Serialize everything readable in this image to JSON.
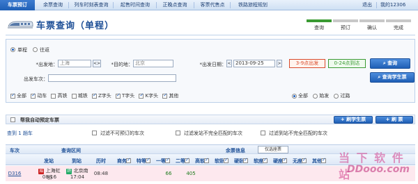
{
  "nav": {
    "tabs": [
      "车票预订",
      "余票查询",
      "列车时刻表查询",
      "起售时间查询",
      "正晚点查询",
      "客票代售点",
      "铁路旅程规划"
    ],
    "active_index": 0,
    "user_text": "我的12306",
    "logout": "退出"
  },
  "header": {
    "title": "车票查询（单程）",
    "steps": [
      {
        "label": "查询",
        "done": true
      },
      {
        "label": "预订",
        "done": false
      },
      {
        "label": "确认",
        "done": false
      },
      {
        "label": "完成",
        "done": false
      }
    ]
  },
  "query": {
    "trip_single": "单程",
    "trip_return": "往返",
    "from_label": "*出发地：",
    "from_value": "上海",
    "swap": "<>",
    "to_label": "*目的地：",
    "to_value": "北京",
    "date_label": "*出发日期：",
    "date_value": "2013-09-25",
    "time_chip_1": "3-9点出发",
    "time_chip_2": "0-24点到达",
    "train_label": "出发车次：",
    "search_button": "查询",
    "student_button": "查询学生票",
    "train_types": [
      "全部",
      "动车",
      "高铁",
      "城铁",
      "Z字头",
      "T字头",
      "K字头",
      "其他"
    ],
    "station_filters": [
      "全部",
      "始发",
      "过路"
    ]
  },
  "auto": {
    "label": "帮我自动预定车票",
    "student_btn": "刷学生票",
    "refresh_btn": "刷  票"
  },
  "filters": {
    "found_prefix": "查到",
    "found_count": "1",
    "found_suffix": "趟车",
    "f1": "过滤不可预订的车次",
    "f2": "过滤发站不完全匹配的车次",
    "f3": "过滤到站不完全匹配的车次"
  },
  "table": {
    "h_train": "车次",
    "h_range": "查询区间",
    "h_seats": "余票信息",
    "h_depart": "发站",
    "h_arrive": "到站",
    "h_duration": "历时",
    "h_only_sleeper": "仅选座票",
    "seat_cols": [
      "商务",
      "特等",
      "一等",
      "二等",
      "高软",
      "软卧",
      "硬卧",
      "软座",
      "硬座",
      "无座",
      "其他"
    ],
    "rows": [
      {
        "train": "D316",
        "from": "上海虹桥",
        "from_time": "08:16",
        "to": "北京南",
        "to_time": "17:04",
        "duration": "08:48",
        "first": "66",
        "second": "405"
      }
    ]
  },
  "watermark": {
    "text": "当 下 软 件 站",
    "site": "DDooo.com"
  }
}
